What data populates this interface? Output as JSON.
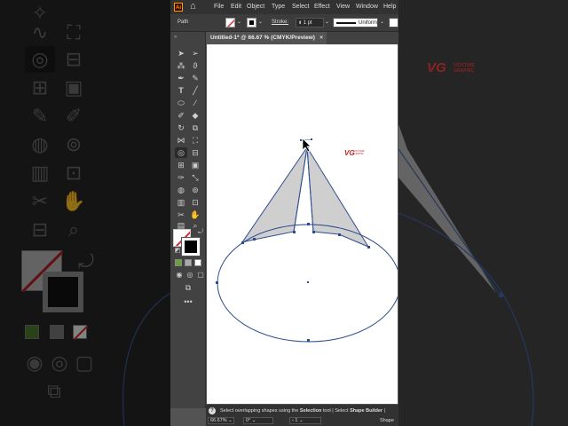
{
  "app": {
    "logo_label": "Ai",
    "menu": [
      "File",
      "Edit",
      "Object",
      "Type",
      "Select",
      "Effect",
      "View",
      "Window",
      "Help"
    ]
  },
  "control_bar": {
    "selection_type": "Path",
    "stroke_label": "Stroke:",
    "stroke_weight": "1 pt",
    "profile": "Uniform"
  },
  "document": {
    "tab_title": "Untitled-1* @ 66.67 % (CMYK/Preview)",
    "close_glyph": "×"
  },
  "status_bar": {
    "hint_prefix": "Select overlapping shapes using the ",
    "hint_tool": "Selection",
    "hint_middle": " tool | Select ",
    "hint_tool2": "Shape Builder",
    "hint_suffix": " |",
    "zoom": "66.67%",
    "rotation": "0°",
    "artboard": "1",
    "tool_name": "Shape"
  },
  "watermark": {
    "logo": "VG",
    "name_line1": "VICKTIME",
    "name_line2": "GRAPHIC"
  },
  "colors": {
    "path_stroke": "#2e4d8f",
    "anchor": "#2e4d8f",
    "cone_fill": "#cfcfcf",
    "canvas_bg": "#ffffff",
    "fill_swatch_slash": "#e3262b"
  },
  "icons": {
    "home": "home-icon",
    "selection": "selection-arrow-icon",
    "direct_selection": "direct-selection-icon",
    "pen": "pen-icon",
    "type": "type-icon",
    "line": "line-icon",
    "ellipse": "ellipse-icon",
    "brush": "brush-icon",
    "shape_builder": "shape-builder-icon",
    "hand": "hand-icon",
    "zoom": "zoom-icon"
  }
}
